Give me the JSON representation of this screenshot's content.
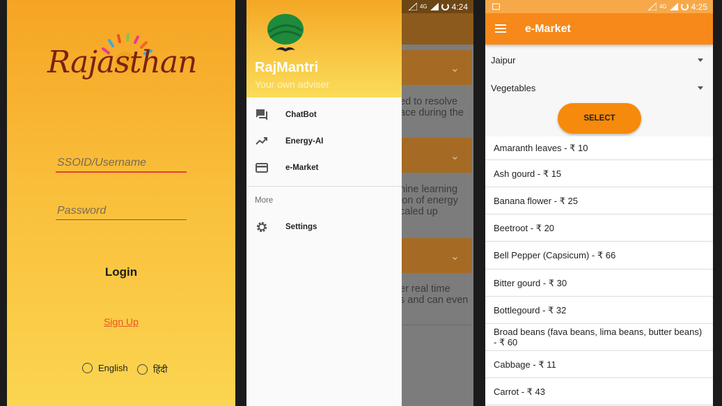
{
  "colors": {
    "accent": "#f6891a",
    "link": "#e8541e",
    "drawer_header": "#f8c845"
  },
  "login": {
    "logo_text": "Rajasthan",
    "username_placeholder": "SSOID/Username",
    "password_placeholder": "Password",
    "login_label": "Login",
    "signup_label": "Sign Up",
    "lang_options": [
      "English",
      "हिंदी"
    ]
  },
  "drawer": {
    "status_time": "4:24",
    "status_network": "4G",
    "app_name": "RajMantri",
    "tagline": "Your own adviser",
    "items": [
      {
        "label": "ChatBot",
        "icon": "chat-icon"
      },
      {
        "label": "Energy-AI",
        "icon": "trending-up-icon"
      },
      {
        "label": "e-Market",
        "icon": "credit-card-icon"
      }
    ],
    "more_label": "More",
    "settings_label": "Settings",
    "behind_text": [
      "ed to resolve\nace during the",
      "hine learning\nion of energy\ncaled up",
      "er real time\ns and can even"
    ]
  },
  "market": {
    "status_time": "4:25",
    "status_network": "4G",
    "title": "e-Market",
    "city": "Jaipur",
    "category": "Vegetables",
    "select_label": "SELECT",
    "items": [
      "Amaranth leaves - ₹ 10",
      "Ash gourd - ₹ 15",
      "Banana flower - ₹ 25",
      "Beetroot - ₹ 20",
      "Bell Pepper (Capsicum) - ₹ 66",
      "Bitter gourd - ₹ 30",
      "Bottlegourd - ₹ 32",
      "Broad beans (fava beans, lima beans, butter beans) - ₹ 60",
      "Cabbage - ₹ 11",
      "Carrot - ₹ 43"
    ]
  }
}
